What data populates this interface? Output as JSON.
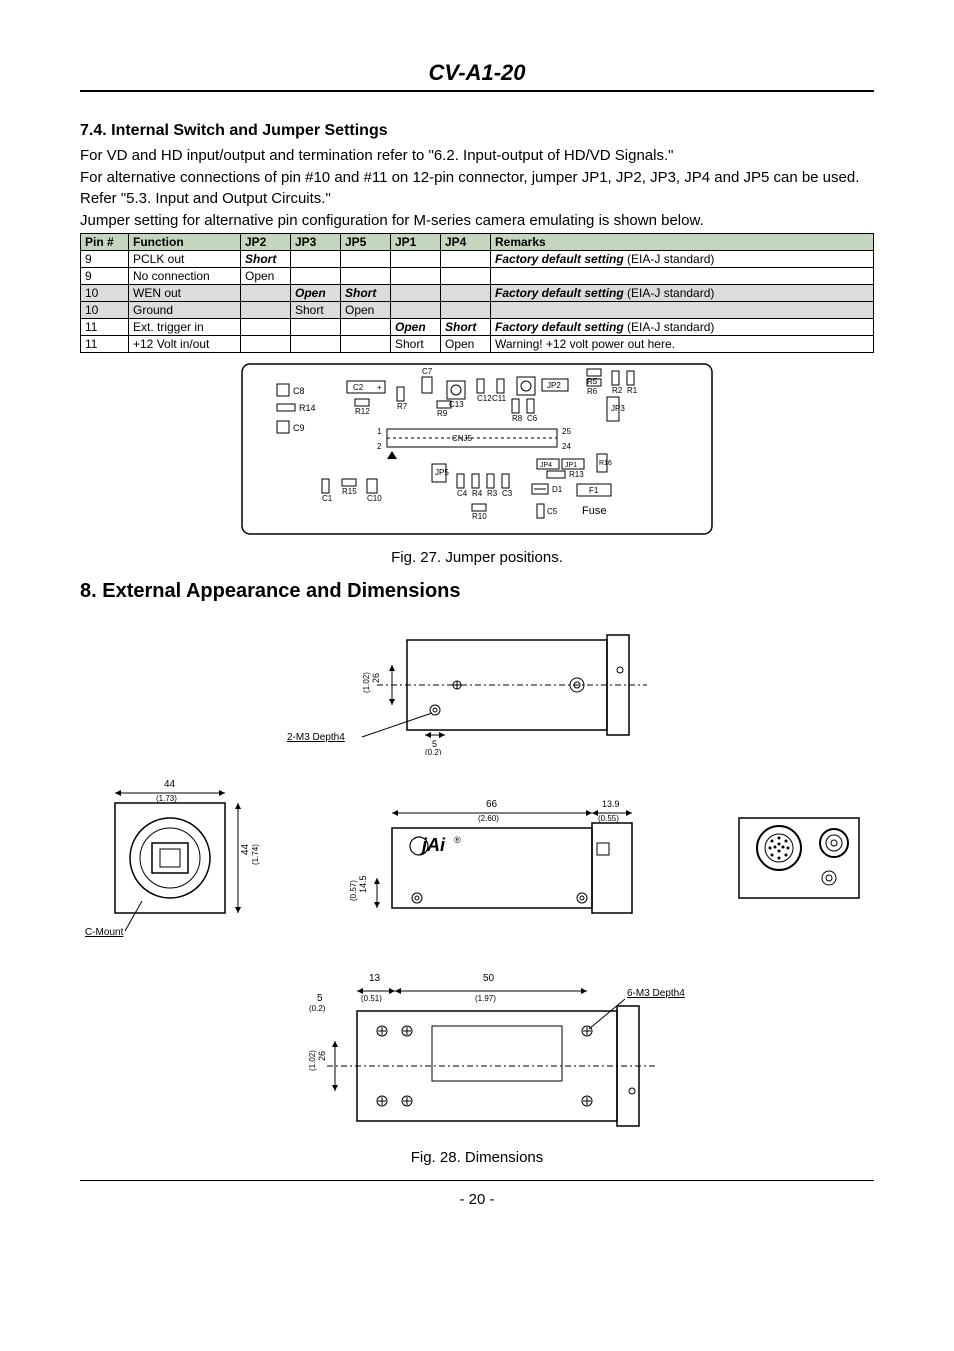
{
  "header": {
    "title": "CV-A1-20"
  },
  "section74": {
    "heading": "7.4. Internal Switch and Jumper Settings",
    "para1": "For VD and HD input/output and termination refer to \"6.2. Input-output of HD/VD Signals.\"",
    "para2": "For alternative connections of pin #10 and #11 on 12-pin connector, jumper JP1, JP2, JP3, JP4 and JP5 can be used. Refer \"5.3. Input and Output Circuits.\"",
    "para3": "Jumper setting for alternative pin configuration for M-series camera emulating is shown below."
  },
  "table": {
    "headers": [
      "Pin #",
      "Function",
      "JP2",
      "JP3",
      "JP5",
      "JP1",
      "JP4",
      "Remarks"
    ],
    "rows": [
      {
        "pin": "9",
        "func": "PCLK out",
        "jp2": "Short",
        "jp3": "",
        "jp5": "",
        "jp1": "",
        "jp4": "",
        "remarks_prefix": "Factory default setting",
        "remarks_suffix": " (EIA-J standard)",
        "shaded": false,
        "jp2_bi": true
      },
      {
        "pin": "9",
        "func": "No connection",
        "jp2": "Open",
        "jp3": "",
        "jp5": "",
        "jp1": "",
        "jp4": "",
        "remarks_prefix": "",
        "remarks_suffix": "",
        "shaded": false
      },
      {
        "pin": "10",
        "func": "WEN out",
        "jp2": "",
        "jp3": "Open",
        "jp5": "Short",
        "jp1": "",
        "jp4": "",
        "remarks_prefix": "Factory default setting",
        "remarks_suffix": " (EIA-J standard)",
        "shaded": true,
        "jp3_bi": true,
        "jp5_bi": true
      },
      {
        "pin": "10",
        "func": "Ground",
        "jp2": "",
        "jp3": "Short",
        "jp5": "Open",
        "jp1": "",
        "jp4": "",
        "remarks_prefix": "",
        "remarks_suffix": "",
        "shaded": true
      },
      {
        "pin": "11",
        "func": "Ext. trigger in",
        "jp2": "",
        "jp3": "",
        "jp5": "",
        "jp1": "Open",
        "jp4": "Short",
        "remarks_prefix": "Factory default setting",
        "remarks_suffix": " (EIA-J standard)",
        "shaded": false,
        "jp1_bi": true,
        "jp4_bi": true
      },
      {
        "pin": "11",
        "func": "+12 Volt in/out",
        "jp2": "",
        "jp3": "",
        "jp5": "",
        "jp1": "Short",
        "jp4": "Open",
        "remarks_prefix": "",
        "remarks_suffix": "Warning! +12 volt power out here.",
        "shaded": false
      }
    ]
  },
  "fig27": {
    "caption": "Fig. 27. Jumper positions."
  },
  "section8": {
    "heading": "8. External Appearance and Dimensions"
  },
  "fig28": {
    "caption": "Fig. 28. Dimensions"
  },
  "dims": {
    "top_left_label": "2-M3 Depth4",
    "top_dim5": "5",
    "top_dim5_imp": "(0.2)",
    "top_dim26": "26",
    "top_dim26_imp": "(1.02)",
    "front_w": "44",
    "front_w_imp": "(1.73)",
    "front_h": "44",
    "front_h_imp": "(1.74)",
    "front_mount": "C-Mount",
    "side_len": "66",
    "side_len_imp": "(2.60)",
    "side_ext": "13.9",
    "side_ext_imp": "(0.55)",
    "side_h": "14.5",
    "side_h_imp": "(0.57)",
    "bottom_13": "13",
    "bottom_13_imp": "(0.51)",
    "bottom_50": "50",
    "bottom_50_imp": "(1.97)",
    "bottom_5": "5",
    "bottom_5_imp": "(0.2)",
    "bottom_26": "26",
    "bottom_26_imp": "(1.02)",
    "bottom_label": "6-M3 Depth4"
  },
  "board": {
    "c8": "C8",
    "r14": "R14",
    "c9": "C9",
    "c2": "C2",
    "r12": "R12",
    "r7": "R7",
    "c7": "C7",
    "c13": "C13",
    "r9": "R9",
    "c12": "C12",
    "c11": "C11",
    "jp2": "JP2",
    "r2": "R2",
    "r1": "R1",
    "c6": "C6",
    "jp3": "JP3",
    "r5": "R5",
    "r6": "R6",
    "r8": "R8",
    "cnj5": "CNJ5",
    "m25": "25",
    "m24": "24",
    "m1": "1",
    "m2": "2",
    "r16": "R16",
    "jp4": "JP4",
    "jp1": "JP1",
    "r13": "R13",
    "c1": "C1",
    "r15": "R15",
    "c10": "C10",
    "jp5": "JP5",
    "c4": "C4",
    "r4": "R4",
    "r3": "R3",
    "c3": "C3",
    "d1": "D1",
    "c5": "C5",
    "f1": "F1",
    "r10": "R10",
    "fuse": "Fuse"
  },
  "footer": {
    "page": "- 20 -"
  }
}
